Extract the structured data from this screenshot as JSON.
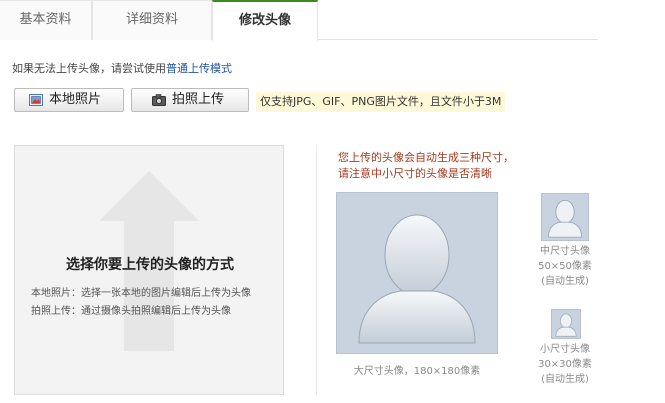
{
  "tabs": [
    {
      "label": "基本资料"
    },
    {
      "label": "详细资料"
    },
    {
      "label": "修改头像"
    }
  ],
  "hint": {
    "text": "如果无法上传头像，请尝试使用",
    "link": "普通上传模式"
  },
  "buttons": {
    "local": "本地照片",
    "camera": "拍照上传"
  },
  "note": "仅支持JPG、GIF、PNG图片文件，且文件小于3M",
  "panel": {
    "title": "选择你要上传的头像的方式",
    "line1": "本地照片：选择一张本地的图片编辑后上传为头像",
    "line2": "拍照上传：通过摄像头拍照编辑后上传为头像"
  },
  "preview": {
    "notice1": "您上传的头像会自动生成三种尺寸，",
    "notice2": "请注意中小尺寸的头像是否清晰",
    "large_caption": "大尺寸头像，180×180像素",
    "medium_title": "中尺寸头像",
    "medium_size": "50×50像素",
    "medium_auto": "(自动生成)",
    "small_title": "小尺寸头像",
    "small_size": "30×30像素",
    "small_auto": "(自动生成)"
  },
  "colors": {
    "active_tab_border": "#3a8c1e",
    "link": "#2155a3",
    "notice": "#a33a1c",
    "note_bg": "#fff8d8"
  }
}
